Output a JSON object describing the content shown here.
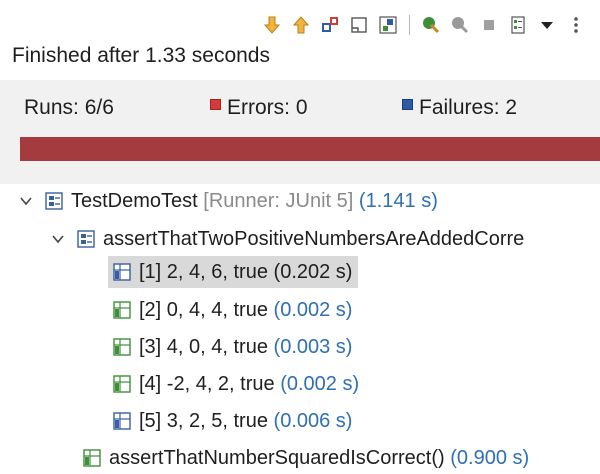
{
  "toolbar": {
    "buttons": [
      "next-failure-icon",
      "previous-failure-icon",
      "show-failures-only-icon",
      "scroll-lock-icon",
      "show-skipped-icon",
      "rerun-test-icon",
      "rerun-failed-first-icon",
      "stop-icon",
      "test-history-icon",
      "view-menu-icon",
      "more-icon"
    ]
  },
  "status": {
    "text": "Finished after 1.33 seconds"
  },
  "counters": {
    "runs": "Runs:  6/6",
    "errors": "Errors:  0",
    "failures": "Failures:  2"
  },
  "progress": {
    "state": "failed",
    "color": "#a43c3f",
    "fraction": 1.0
  },
  "tree": {
    "root": {
      "name": "TestDemoTest",
      "runner": "[Runner: JUnit 5]",
      "time": "(1.141 s)"
    },
    "method1": {
      "name": "assertThatTwoPositiveNumbersAreAddedCorre"
    },
    "cases": [
      {
        "label": "[1] 2, 4, 6, true",
        "time": "(0.202 s)",
        "status": "failed"
      },
      {
        "label": "[2] 0, 4, 4, true",
        "time": "(0.002 s)",
        "status": "passed"
      },
      {
        "label": "[3] 4, 0, 4, true",
        "time": "(0.003 s)",
        "status": "passed"
      },
      {
        "label": "[4] -2, 4, 2, true",
        "time": "(0.002 s)",
        "status": "passed"
      },
      {
        "label": "[5] 3, 2, 5, true",
        "time": "(0.006 s)",
        "status": "failed"
      }
    ],
    "method2": {
      "name": "assertThatNumberSquaredIsCorrect()",
      "time": "(0.900 s)"
    }
  },
  "colors": {
    "failure_red": "#a43c3f",
    "time_blue": "#2f6fb3",
    "pass_green": "#3f8f3a",
    "fail_blue": "#2e5aa6"
  }
}
